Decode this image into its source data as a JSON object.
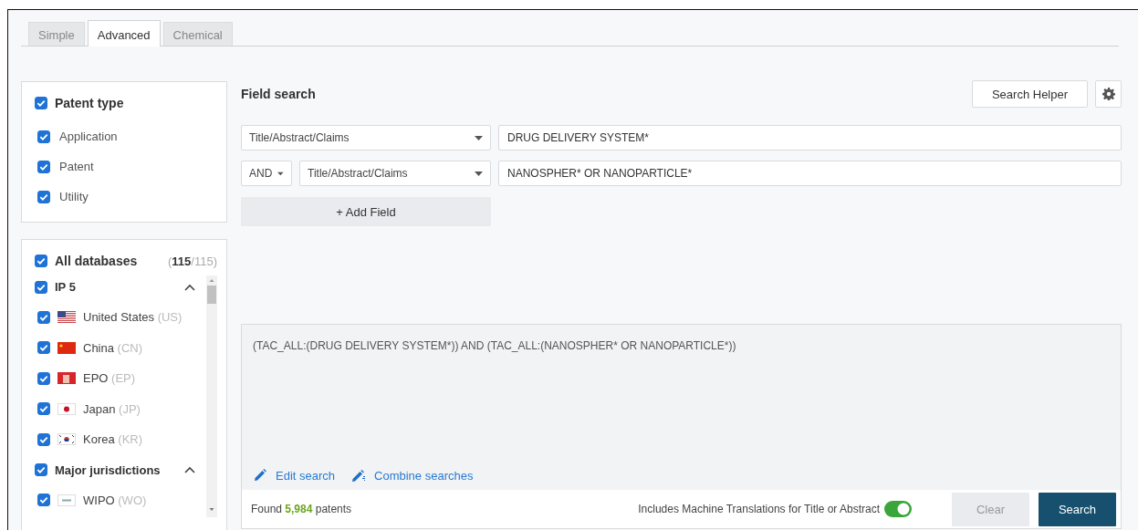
{
  "tabs": [
    {
      "label": "Simple",
      "selected": false
    },
    {
      "label": "Advanced",
      "selected": true
    },
    {
      "label": "Chemical",
      "selected": false
    }
  ],
  "patent_type": {
    "label": "Patent type",
    "checked": true,
    "items": [
      {
        "label": "Application",
        "checked": true
      },
      {
        "label": "Patent",
        "checked": true
      },
      {
        "label": "Utility",
        "checked": true
      }
    ]
  },
  "databases": {
    "label": "All databases",
    "checked": true,
    "count": "(**115**/115)",
    "groups": [
      {
        "label": "IP 5",
        "checked": true,
        "expanded": true,
        "items": [
          {
            "label": "United States",
            "code": "(US)",
            "kind": "us",
            "checked": true
          },
          {
            "label": "China",
            "code": "(CN)",
            "kind": "cn",
            "checked": true
          },
          {
            "label": "EPO",
            "code": "(EP)",
            "kind": "ep",
            "checked": true
          },
          {
            "label": "Japan",
            "code": "(JP)",
            "kind": "jp",
            "checked": true
          },
          {
            "label": "Korea",
            "code": "(KR)",
            "kind": "kr",
            "checked": true
          }
        ]
      },
      {
        "label": "Major jurisdictions",
        "checked": true,
        "expanded": true,
        "items": [
          {
            "label": "WIPO",
            "code": "(WO)",
            "kind": "wo",
            "checked": true
          }
        ]
      }
    ]
  },
  "field_search": {
    "title": "Field search",
    "helper_button": "Search Helper",
    "rows": [
      {
        "field": "Title/Abstract/Claims",
        "value": "DRUG DELIVERY SYSTEM*"
      },
      {
        "operator": "AND",
        "field": "Title/Abstract/Claims",
        "value": "NANOSPHER* OR NANOPARTICLE*"
      }
    ],
    "add_field": "+ Add Field"
  },
  "query": {
    "text": "(TAC_ALL:(DRUG DELIVERY SYSTEM*)) AND (TAC_ALL:(NANOSPHER* OR NANOPARTICLE*))",
    "links": [
      {
        "label": "Edit search",
        "kind": "edit"
      },
      {
        "label": "Combine searches",
        "kind": "combine"
      }
    ],
    "found": "Found **5,984** patents",
    "translation_label": "Includes Machine Translations for Title or Abstract",
    "translation_on": true,
    "buttons": [
      {
        "label": "Clear",
        "kind": "secondary"
      },
      {
        "label": "Search",
        "kind": "primary"
      }
    ]
  }
}
